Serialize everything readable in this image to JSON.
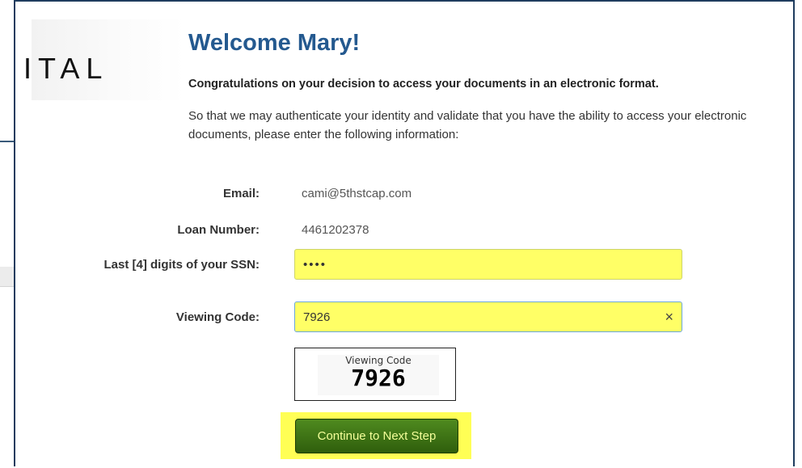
{
  "logo": {
    "text": "ITAL"
  },
  "header": {
    "title": "Welcome Mary!",
    "congrats": "Congratulations on your decision to access your documents in an electronic format.",
    "intro": "So that we may authenticate your identity and validate that you have the ability to access your electronic documents, please enter the following information:"
  },
  "form": {
    "email_label": "Email:",
    "email_value": "cami@5thstcap.com",
    "loan_label": "Loan Number:",
    "loan_value": "4461202378",
    "ssn_label": "Last [4] digits of your SSN:",
    "ssn_value": "••••",
    "code_label": "Viewing Code:",
    "code_value": "7926",
    "clear_icon": "×"
  },
  "captcha": {
    "label": "Viewing Code",
    "code": "7926"
  },
  "actions": {
    "continue_label": "Continue to Next Step"
  },
  "colors": {
    "title": "#24598f",
    "field_highlight": "#ffff66",
    "button": "#3a6f14",
    "button_text": "#f4ff9a"
  }
}
